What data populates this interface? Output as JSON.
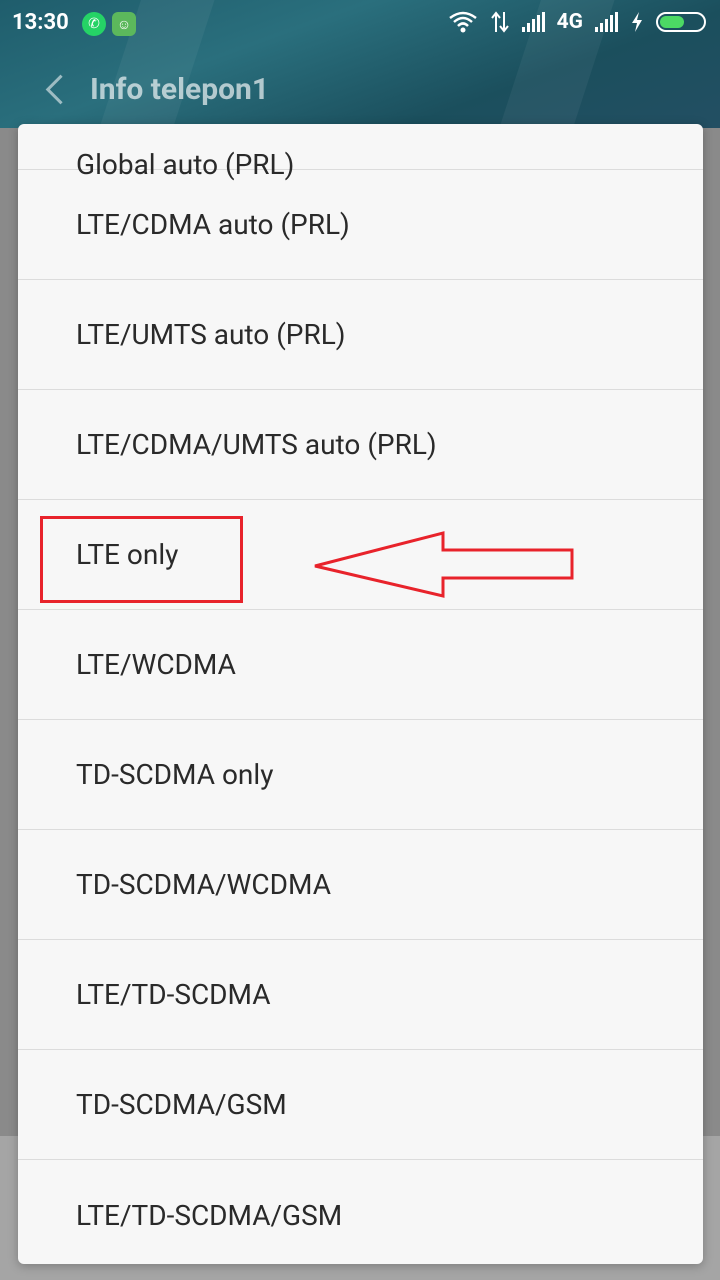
{
  "status_bar": {
    "time": "13:30",
    "network": "4G",
    "icons": [
      "whatsapp-icon",
      "grammarly-icon",
      "wifi-icon",
      "data-transfer-icon",
      "signal-icon",
      "signal-icon-2",
      "charging-icon",
      "battery-icon"
    ]
  },
  "header": {
    "back_icon": "chevron-left-icon",
    "title": "Info telepon1"
  },
  "dialog": {
    "options": [
      {
        "label": "Global auto (PRL)"
      },
      {
        "label": "LTE/CDMA auto (PRL)"
      },
      {
        "label": "LTE/UMTS auto (PRL)"
      },
      {
        "label": "LTE/CDMA/UMTS auto (PRL)"
      },
      {
        "label": "LTE only"
      },
      {
        "label": "LTE/WCDMA"
      },
      {
        "label": "TD-SCDMA only"
      },
      {
        "label": "TD-SCDMA/WCDMA"
      },
      {
        "label": "LTE/TD-SCDMA"
      },
      {
        "label": "TD-SCDMA/GSM"
      },
      {
        "label": "LTE/TD-SCDMA/GSM"
      }
    ]
  },
  "annotation": {
    "color": "#e8232b",
    "highlighted_option": "LTE only"
  }
}
